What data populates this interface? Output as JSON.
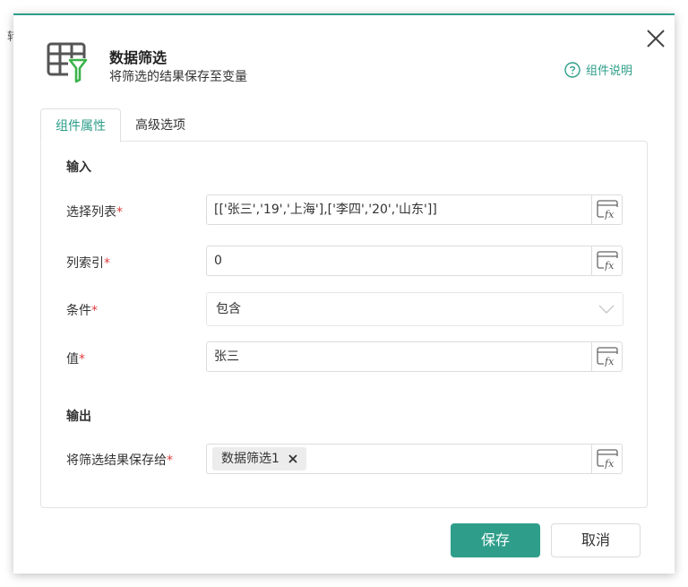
{
  "background": {
    "edge_char": "转"
  },
  "dialog": {
    "title": "数据筛选",
    "subtitle": "将筛选的结果保存至变量",
    "help_label": "组件说明",
    "accent_color": "#2e9e8a"
  },
  "tabs": [
    {
      "label": "组件属性",
      "active": true
    },
    {
      "label": "高级选项",
      "active": false
    }
  ],
  "input_section": {
    "label": "输入",
    "fields": {
      "select_list": {
        "label": "选择列表",
        "required_mark": "*",
        "value": "[['张三','19','上海'],['李四','20','山东']]"
      },
      "column_index": {
        "label": "列索引",
        "required_mark": "*",
        "value": "0"
      },
      "condition": {
        "label": "条件",
        "required_mark": "*",
        "value": "包含"
      },
      "value": {
        "label": "值",
        "required_mark": "*",
        "value": "张三"
      }
    }
  },
  "output_section": {
    "label": "输出",
    "save_to": {
      "label": "将筛选结果保存给",
      "required_mark": "*",
      "tag": "数据筛选1"
    }
  },
  "footer": {
    "save_label": "保存",
    "cancel_label": "取消"
  },
  "icons": {
    "close": "close-icon",
    "header": "table-filter-icon",
    "help": "question-circle-icon",
    "fx": "function-fx-icon",
    "chevron": "chevron-down-icon",
    "tag_close": "x-icon"
  }
}
